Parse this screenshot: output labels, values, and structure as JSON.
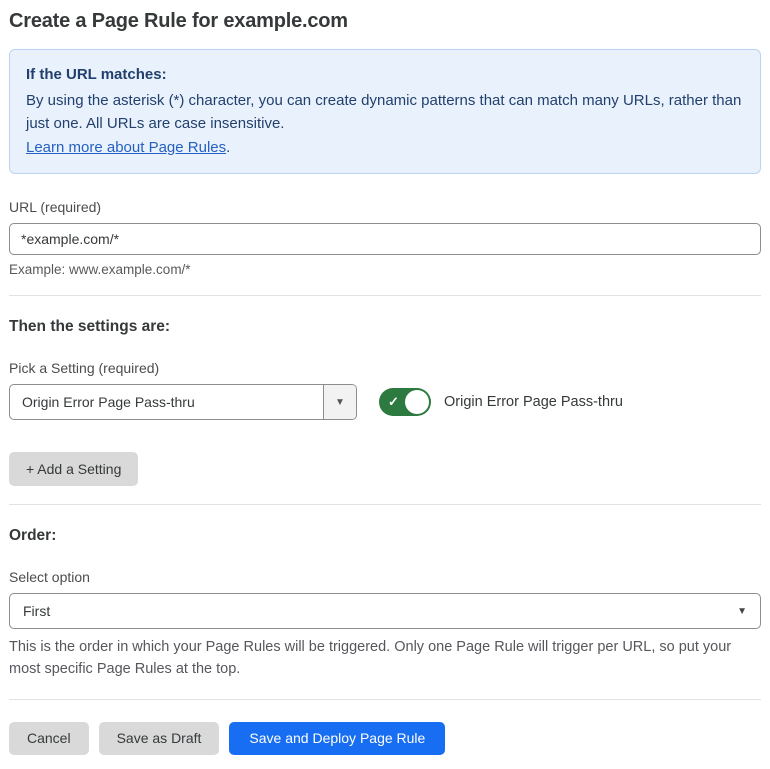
{
  "page": {
    "title": "Create a Page Rule for example.com"
  },
  "info_box": {
    "heading": "If the URL matches:",
    "body": "By using the asterisk (*) character, you can create dynamic patterns that can match many URLs, rather than just one. All URLs are case insensitive.",
    "link": "Learn more about Page Rules",
    "link_suffix": "."
  },
  "url_field": {
    "label": "URL (required)",
    "value": "*example.com/*",
    "hint": "Example: www.example.com/*"
  },
  "settings_section": {
    "heading": "Then the settings are:",
    "picker_label": "Pick a Setting (required)",
    "picker_value": "Origin Error Page Pass-thru",
    "toggle_label": "Origin Error Page Pass-thru",
    "toggle_state": "on",
    "add_setting_label": "+ Add a Setting"
  },
  "order_section": {
    "heading": "Order:",
    "select_label": "Select option",
    "select_value": "First",
    "help_text": "This is the order in which your Page Rules will be triggered. Only one Page Rule will trigger per URL, so put your most specific Page Rules at the top."
  },
  "footer": {
    "cancel_label": "Cancel",
    "save_draft_label": "Save as Draft",
    "save_deploy_label": "Save and Deploy Page Rule"
  },
  "icons": {
    "dropdown_arrow": "▼",
    "toggle_check": "✓"
  },
  "colors": {
    "info_bg": "#e9f2fc",
    "info_border": "#bad3f1",
    "info_text": "#22406e",
    "link_blue": "#2660c1",
    "toggle_on_green": "#2c7a3f",
    "primary_button_blue": "#186ef3",
    "secondary_button_gray": "#d9d9d9",
    "divider_gray": "#e2e2e2"
  }
}
